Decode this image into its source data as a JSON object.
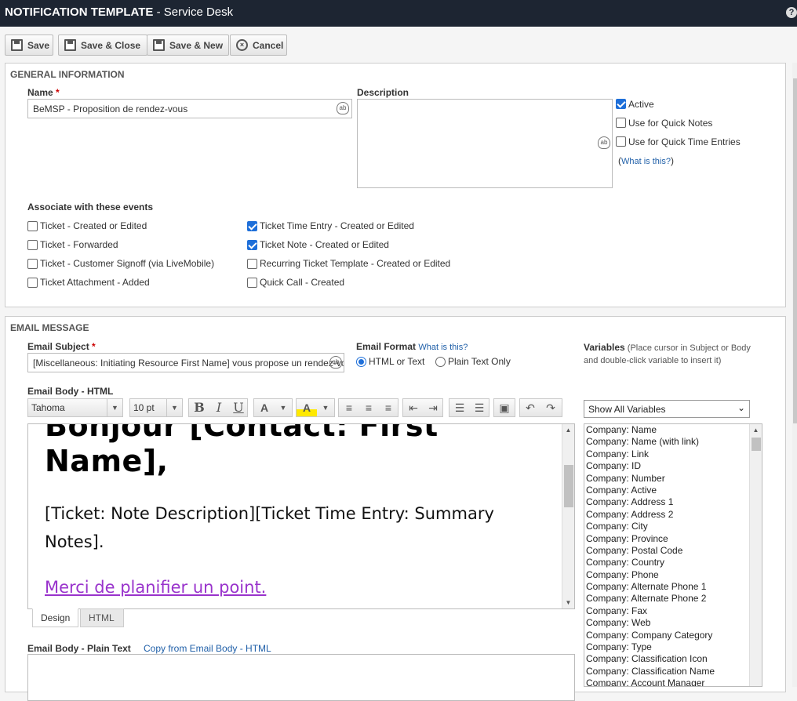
{
  "title": {
    "module": "NOTIFICATION TEMPLATE",
    "sep": " - ",
    "context": "Service Desk"
  },
  "toolbar": {
    "save": "Save",
    "save_close": "Save & Close",
    "save_new": "Save & New",
    "cancel": "Cancel"
  },
  "general": {
    "heading": "GENERAL INFORMATION",
    "name_label": "Name",
    "required_mark": "*",
    "name_value": "BeMSP - Proposition de rendez-vous",
    "description_label": "Description",
    "description_value": "",
    "active_label": "Active",
    "active_checked": true,
    "quick_notes_label": "Use for Quick Notes",
    "quick_notes_checked": false,
    "quick_time_label": "Use for Quick Time Entries",
    "quick_time_checked": false,
    "what_open": "(",
    "what_link": "What is this?",
    "what_close": ")",
    "events_label": "Associate with these events",
    "events": [
      {
        "label": "Ticket - Created or Edited",
        "checked": false
      },
      {
        "label": "Ticket - Forwarded",
        "checked": false
      },
      {
        "label": "Ticket - Customer Signoff (via LiveMobile)",
        "checked": false
      },
      {
        "label": "Ticket Attachment - Added",
        "checked": false
      },
      {
        "label": "Ticket Time Entry - Created or Edited",
        "checked": true
      },
      {
        "label": "Ticket Note - Created or Edited",
        "checked": true
      },
      {
        "label": "Recurring Ticket Template - Created or Edited",
        "checked": false
      },
      {
        "label": "Quick Call - Created",
        "checked": false
      }
    ]
  },
  "email": {
    "heading": "EMAIL MESSAGE",
    "subject_label": "Email Subject",
    "subject_value": "[Miscellaneous: Initiating Resource First Name] vous propose un rendez-vous",
    "format_label": "Email Format",
    "format_help": "What is this?",
    "format_html": "HTML or Text",
    "format_plain": "Plain Text Only",
    "format_selected": "html",
    "variables_label": "Variables",
    "variables_hint": " (Place cursor in Subject or Body and double-click variable to insert it)",
    "body_html_label": "Email Body - HTML",
    "font_name": "Tahoma",
    "font_size": "10 pt",
    "editor_heading": "Bonjour [Contact: First Name],",
    "editor_paragraph": "[Ticket: Note Description][Ticket Time Entry: Summary Notes].",
    "editor_link": "Merci de planifier un point.",
    "tab_design": "Design",
    "tab_html": "HTML",
    "plain_label": "Email Body - Plain Text",
    "copy_link": "Copy from Email Body - HTML",
    "variables_filter": "Show All Variables",
    "variables": [
      "Company: Name",
      "Company: Name (with link)",
      "Company: Link",
      "Company: ID",
      "Company: Number",
      "Company: Active",
      "Company: Address 1",
      "Company: Address 2",
      "Company: City",
      "Company: Province",
      "Company: Postal Code",
      "Company: Country",
      "Company: Phone",
      "Company: Alternate Phone 1",
      "Company: Alternate Phone 2",
      "Company: Fax",
      "Company: Web",
      "Company: Company Category",
      "Company: Type",
      "Company: Classification Icon",
      "Company: Classification Name",
      "Company: Account Manager"
    ]
  },
  "colors": {
    "titlebar": "#1d2532",
    "accent": "#1e6fd9",
    "link": "#1f5fa8",
    "editor_link": "#9933cc"
  }
}
